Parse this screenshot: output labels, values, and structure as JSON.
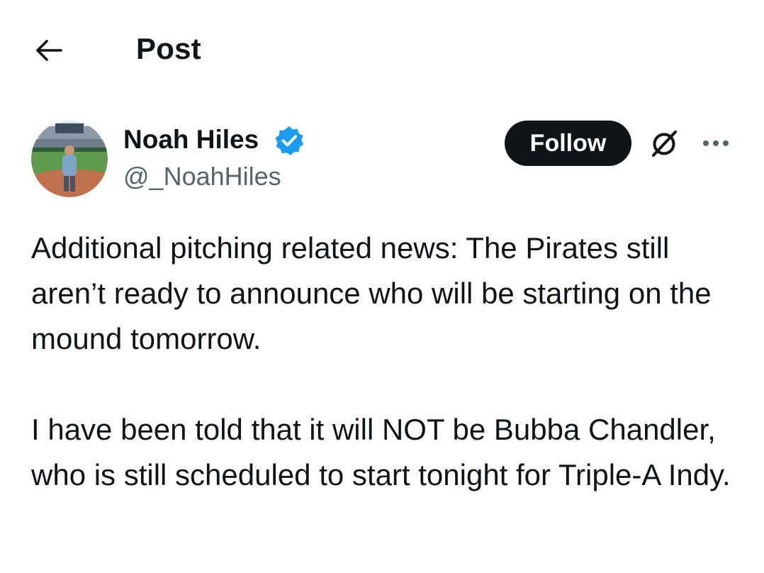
{
  "header": {
    "back_icon": "arrow-left-icon",
    "title": "Post"
  },
  "author": {
    "name": "Noah Hiles",
    "handle": "@_NoahHiles",
    "verified": true,
    "verified_icon": "verified-badge-icon",
    "verified_color": "#1d9bf0",
    "follow_label": "Follow",
    "grok_icon": "grok-icon",
    "more_icon": "more-horizontal-icon"
  },
  "post": {
    "paragraphs": [
      "Additional pitching related news: The Pirates still aren’t ready to announce who will be starting on the mound tomorrow.",
      "I have been told that it will NOT be Bubba Chandler, who is still scheduled to start tonight for Triple-A Indy."
    ]
  },
  "colors": {
    "text_primary": "#0f1419",
    "text_secondary": "#536471",
    "follow_button_bg": "#0f1419",
    "follow_button_text": "#ffffff",
    "background": "#ffffff"
  }
}
